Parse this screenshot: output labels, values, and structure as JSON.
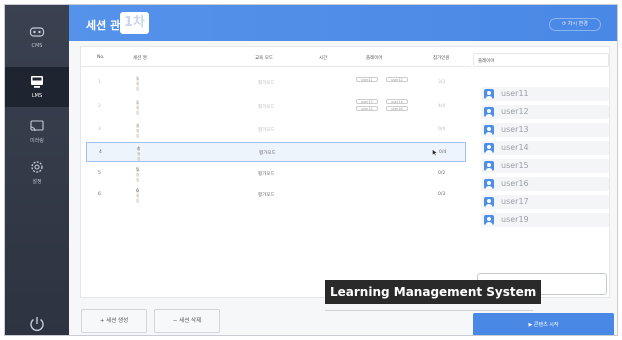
{
  "sidebar": {
    "items": [
      {
        "label": "CMS",
        "icon": "gamepad-icon"
      },
      {
        "label": "LMS",
        "icon": "monitor-icon"
      },
      {
        "label": "미러링",
        "icon": "cast-icon"
      },
      {
        "label": "설정",
        "icon": "gear-icon"
      }
    ],
    "active": "LMS",
    "power_icon": "power-icon"
  },
  "header": {
    "title": "세션 관리",
    "round": "1차",
    "right_button": "차시 변경"
  },
  "table": {
    "columns": [
      "No.",
      "세션 명",
      "교육 모드",
      "시간",
      "플레이어",
      "참가인원"
    ],
    "rows": [
      {
        "no": "1",
        "name": "1",
        "sub": "임정임",
        "mode": "평가모드",
        "time": "",
        "players": [
          "user11",
          "user12"
        ],
        "count": "3/3",
        "state": "dim"
      },
      {
        "no": "2",
        "name": "2",
        "sub": "임정임",
        "mode": "평가모드",
        "time": "",
        "players": [
          "user13",
          "user14",
          "user15",
          "user16"
        ],
        "count": "4/4",
        "state": "dim"
      },
      {
        "no": "3",
        "name": "3",
        "sub": "임정임",
        "mode": "평가모드",
        "time": "",
        "players": [],
        "count": "0/4",
        "state": "dim"
      },
      {
        "no": "4",
        "name": "4",
        "sub": "임정임",
        "mode": "평가모드",
        "time": "",
        "players": [],
        "count": "0/4",
        "state": "selected"
      },
      {
        "no": "5",
        "name": "5",
        "sub": "임정임",
        "mode": "평가모드",
        "time": "",
        "players": [],
        "count": "0/2",
        "state": "normal"
      },
      {
        "no": "6",
        "name": "6",
        "sub": "임정임",
        "mode": "평가모드",
        "time": "",
        "players": [],
        "count": "0/3",
        "state": "normal"
      }
    ]
  },
  "player_panel": {
    "title": "플레이어",
    "users": [
      "user11",
      "user12",
      "user13",
      "user14",
      "user15",
      "user16",
      "user17",
      "user19"
    ]
  },
  "buttons": {
    "create": "+ 세션 생성",
    "delete": "− 세션 삭제",
    "start": "▶ 콘텐츠 시작"
  },
  "caption": "Learning Management System",
  "colors": {
    "accent": "#4a88e6",
    "sidebar": "#323946"
  }
}
